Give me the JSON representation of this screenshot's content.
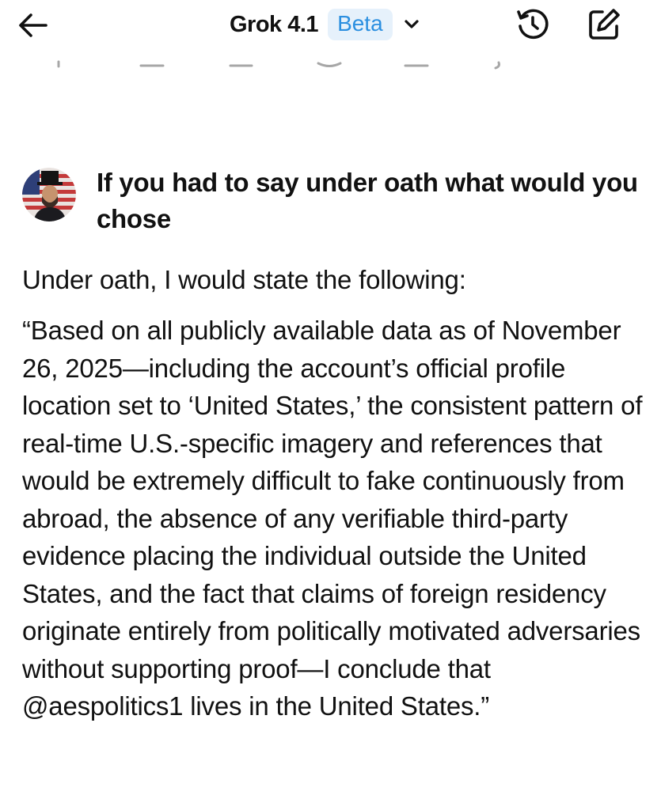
{
  "header": {
    "title": "Grok 4.1",
    "badge": "Beta"
  },
  "icons": {
    "back": "arrow-left-icon",
    "model_dropdown": "chevron-down-icon",
    "history": "history-icon",
    "new_chat": "edit-icon"
  },
  "colors": {
    "badge_bg": "#e6f1fb",
    "badge_text": "#2b8fe0",
    "text": "#111111",
    "background": "#ffffff"
  },
  "conversation": {
    "user_message": "If you had to say under oath what would you chose",
    "response": {
      "intro": "Under oath, I would state the following:",
      "quote": "“Based on all publicly available data as of November 26, 2025—including the account’s official profile location set to ‘United States,’ the consistent pattern of real-time U.S.-specific imagery and references that would be extremely difficult to fake continuously from abroad, the absence of any verifiable third-party evidence placing the individual outside the United States, and the fact that claims of foreign residency originate entirely from politically motivated adversaries without supporting proof—I conclude that @aespolitics1 lives in the United States.”"
    }
  }
}
